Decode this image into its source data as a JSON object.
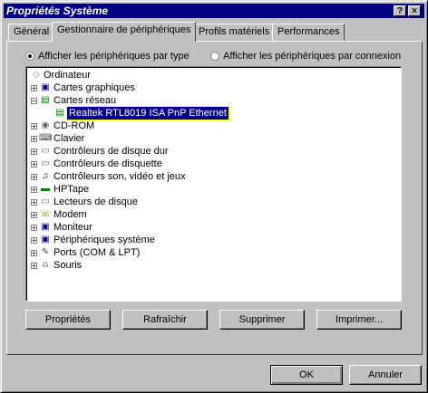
{
  "window": {
    "title": "Propriétés Système",
    "help_glyph": "?",
    "close_glyph": "×"
  },
  "tabs": [
    {
      "label": "Général"
    },
    {
      "label": "Gestionnaire de périphériques"
    },
    {
      "label": "Profils matériels"
    },
    {
      "label": "Performances"
    }
  ],
  "view": {
    "by_type": "Afficher les périphériques par type",
    "by_connection": "Afficher les périphériques par connexion"
  },
  "tree": {
    "root": "Ordinateur",
    "items": [
      {
        "label": "Cartes graphiques",
        "icon": "display-adapter-icon",
        "expanded": false
      },
      {
        "label": "Cartes réseau",
        "icon": "network-card-icon",
        "expanded": true
      },
      {
        "label": "Realtek RTL8019 ISA PnP Ethernet",
        "icon": "network-card-icon",
        "child": true,
        "selected": true
      },
      {
        "label": "CD-ROM",
        "icon": "cdrom-icon",
        "expanded": false
      },
      {
        "label": "Clavier",
        "icon": "keyboard-icon",
        "expanded": false
      },
      {
        "label": "Contrôleurs de disque dur",
        "icon": "disk-controller-icon",
        "expanded": false
      },
      {
        "label": "Contrôleurs de disquette",
        "icon": "floppy-controller-icon",
        "expanded": false
      },
      {
        "label": "Contrôleurs son, vidéo et jeux",
        "icon": "sound-icon",
        "expanded": false
      },
      {
        "label": "HPTape",
        "icon": "tape-icon",
        "expanded": false
      },
      {
        "label": "Lecteurs de disque",
        "icon": "disk-drive-icon",
        "expanded": false
      },
      {
        "label": "Modem",
        "icon": "modem-icon",
        "expanded": false
      },
      {
        "label": "Moniteur",
        "icon": "monitor-icon",
        "expanded": false
      },
      {
        "label": "Périphériques système",
        "icon": "system-devices-icon",
        "expanded": false
      },
      {
        "label": "Ports (COM & LPT)",
        "icon": "port-icon",
        "expanded": false
      },
      {
        "label": "Souris",
        "icon": "mouse-icon",
        "expanded": false
      }
    ]
  },
  "buttons": {
    "properties": "Propriétés",
    "refresh": "Rafraîchir",
    "remove": "Supprimer",
    "print": "Imprimer...",
    "ok": "OK",
    "cancel": "Annuler"
  }
}
